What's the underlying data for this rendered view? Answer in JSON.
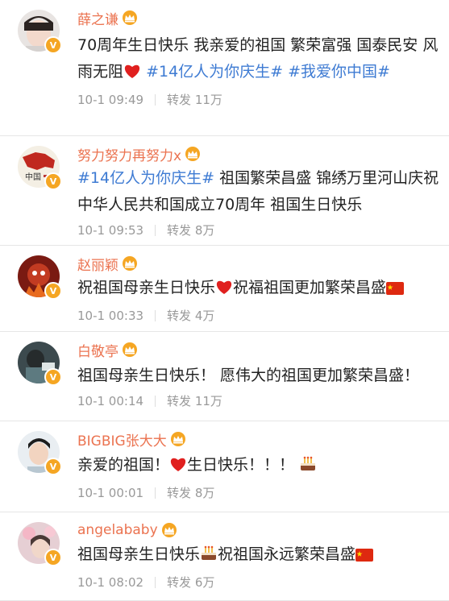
{
  "posts": [
    {
      "name": "薛之谦",
      "text_segments": [
        {
          "t": "70周年生日快乐 我亲爱的祖国 繁荣富强 国泰民安 风雨无阻",
          "topic": false
        },
        {
          "t": "heart",
          "emoji": true
        },
        {
          "t": "  ",
          "topic": false
        },
        {
          "t": "#14亿人为你庆生#",
          "topic": true
        },
        {
          "t": " ",
          "topic": false
        },
        {
          "t": "#我爱你中国#",
          "topic": true
        }
      ],
      "time": "10-1 09:49",
      "repost_label": "转发",
      "repost_count": "11万"
    },
    {
      "name": "努力努力再努力x",
      "text_segments": [
        {
          "t": "#14亿人为你庆生#",
          "topic": true
        },
        {
          "t": " 祖国繁荣昌盛 锦绣万里河山庆祝中华人民共和国成立70周年 祖国生日快乐",
          "topic": false
        }
      ],
      "time": "10-1 09:53",
      "repost_label": "转发",
      "repost_count": "8万"
    },
    {
      "name": "赵丽颖",
      "text_segments": [
        {
          "t": "祝祖国母亲生日快乐",
          "topic": false
        },
        {
          "t": "heart",
          "emoji": true
        },
        {
          "t": "祝福祖国更加繁荣昌盛",
          "topic": false
        },
        {
          "t": "flag",
          "emoji": true
        }
      ],
      "time": "10-1 00:33",
      "repost_label": "转发",
      "repost_count": "4万"
    },
    {
      "name": "白敬亭",
      "text_segments": [
        {
          "t": "祖国母亲生日快乐！ 愿伟大的祖国更加繁荣昌盛！",
          "topic": false
        }
      ],
      "time": "10-1 00:14",
      "repost_label": "转发",
      "repost_count": "11万"
    },
    {
      "name": "BIGBIG张大大",
      "text_segments": [
        {
          "t": "亲爱的祖国！",
          "topic": false
        },
        {
          "t": "heart",
          "emoji": true
        },
        {
          "t": "生日快乐！！！ ",
          "topic": false
        },
        {
          "t": "cake",
          "emoji": true
        }
      ],
      "time": "10-1 00:01",
      "repost_label": "转发",
      "repost_count": "8万"
    },
    {
      "name": "angelababy",
      "text_segments": [
        {
          "t": "祖国母亲生日快乐",
          "topic": false
        },
        {
          "t": "cake",
          "emoji": true
        },
        {
          "t": "祝祖国永远繁荣昌盛",
          "topic": false
        },
        {
          "t": "flag",
          "emoji": true
        }
      ],
      "time": "10-1 08:02",
      "repost_label": "转发",
      "repost_count": "6万"
    }
  ],
  "colors": {
    "username": "#eb7350",
    "topic": "#3e7bd3",
    "meta": "#999999",
    "verified_badge": "#f5a623"
  },
  "icons": {
    "verified": "verified-v-badge-icon",
    "crown": "vip-crown-icon"
  },
  "badge_letter": "V"
}
